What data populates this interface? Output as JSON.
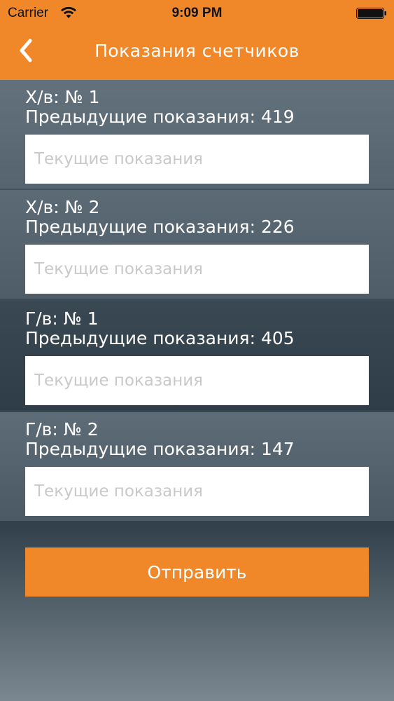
{
  "status_bar": {
    "carrier": "Carrier",
    "time": "9:09 PM",
    "icons": [
      "wifi-icon",
      "battery-icon"
    ]
  },
  "nav": {
    "title": "Показания счетчиков",
    "back_icon": "chevron-left-icon"
  },
  "meters": [
    {
      "name": "Х/в: № 1",
      "previous": "Предыдущие показания: 419",
      "input_value": "",
      "placeholder": "Текущие показания"
    },
    {
      "name": "Х/в: № 2",
      "previous": "Предыдущие показания: 226",
      "input_value": "",
      "placeholder": "Текущие показания"
    },
    {
      "name": "Г/в: № 1",
      "previous": "Предыдущие показания: 405",
      "input_value": "",
      "placeholder": "Текущие показания"
    },
    {
      "name": "Г/в: № 2",
      "previous": "Предыдущие показания: 147",
      "input_value": "",
      "placeholder": "Текущие показания"
    }
  ],
  "submit_label": "Отправить",
  "colors": {
    "accent": "#f0882a",
    "text_light": "#ffffff",
    "placeholder": "#c9c9c9"
  }
}
